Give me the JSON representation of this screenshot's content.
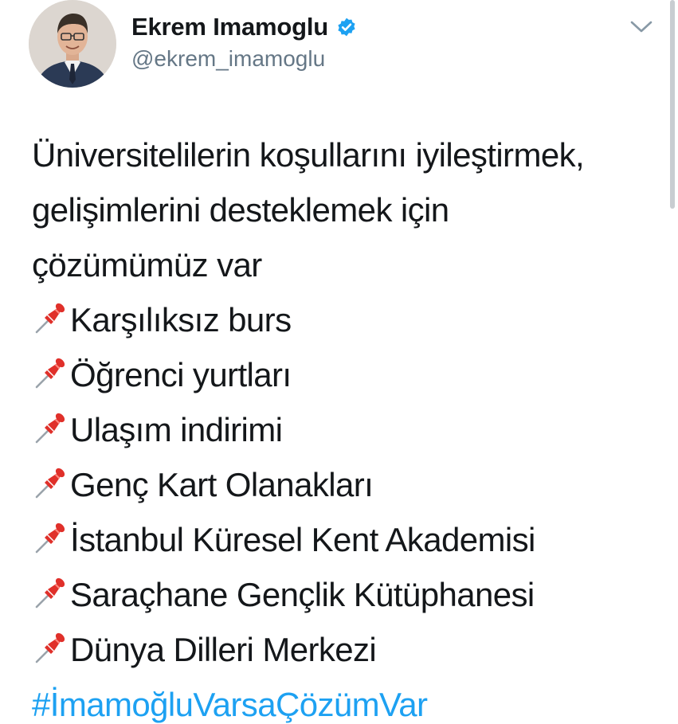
{
  "header": {
    "display_name": "Ekrem Imamoglu",
    "handle": "@ekrem_imamoglu",
    "verified": true,
    "avatar_icon": "profile-photo",
    "menu_icon": "chevron-down-icon"
  },
  "tweet": {
    "intro_lines": [
      "Üniversitelilerin koşullarını iyileştirmek,",
      "gelişimlerini desteklemek için",
      "çözümümüz var"
    ],
    "bullet_icon": "pushpin-emoji",
    "bullets": [
      "Karşılıksız burs",
      "Öğrenci yurtları",
      "Ulaşım indirimi",
      "Genç Kart Olanakları",
      "İstanbul Küresel Kent Akademisi",
      "Saraçhane Gençlik Kütüphanesi",
      "Dünya Dilleri Merkezi"
    ],
    "hashtag": "#İmamoğluVarsaÇözümVar"
  },
  "colors": {
    "text": "#14171a",
    "secondary": "#657786",
    "link": "#1da1f2",
    "verified": "#1da1f2",
    "pin": "#e0302a"
  }
}
